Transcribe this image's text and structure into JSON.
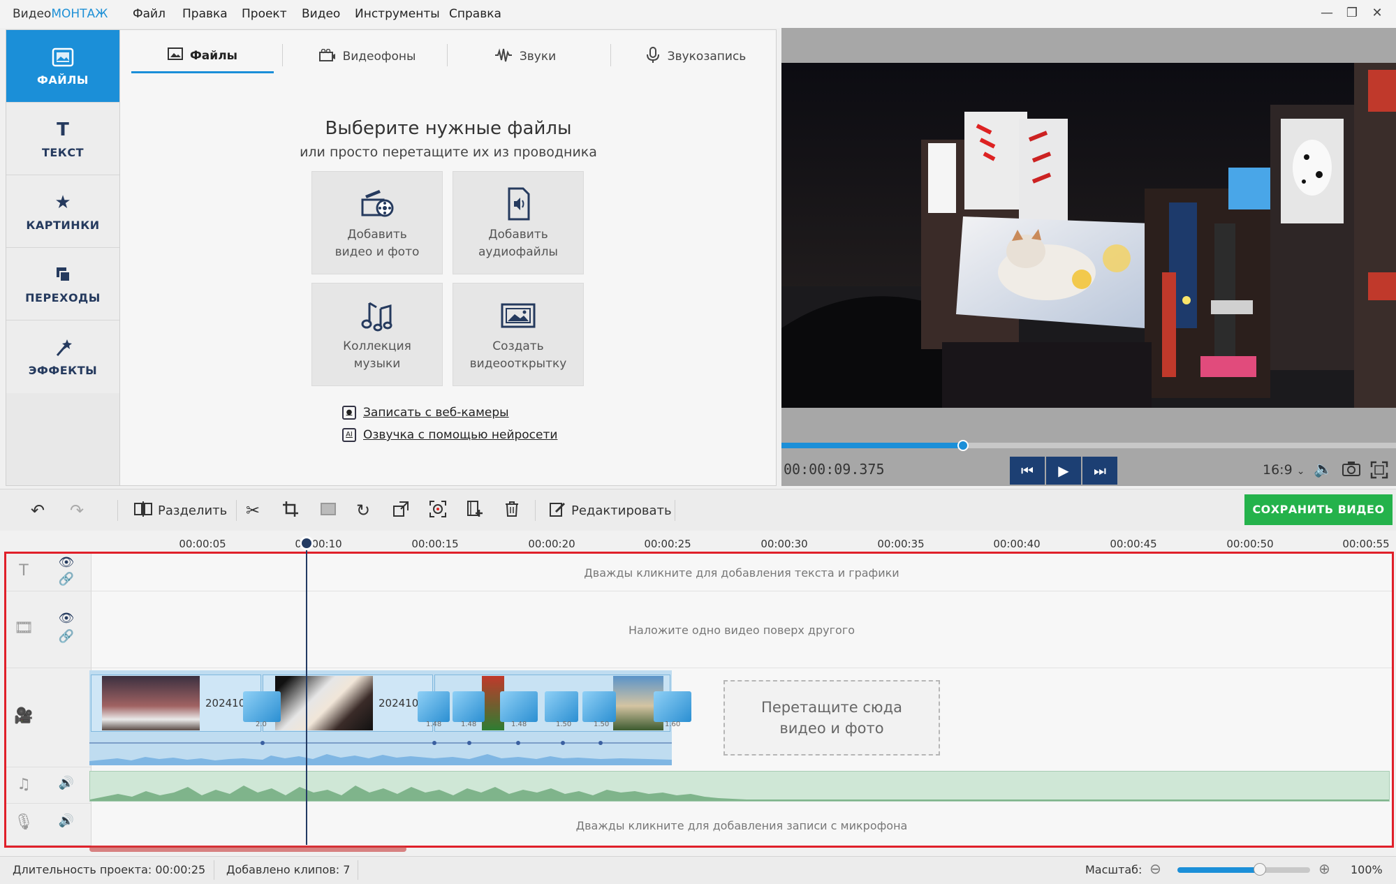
{
  "app": {
    "title_prefix": "Видео",
    "title_accent": "МОНТАЖ"
  },
  "menu": [
    "Файл",
    "Правка",
    "Проект",
    "Видео",
    "Инструменты",
    "Справка"
  ],
  "window_controls": {
    "minimize": "—",
    "restore": "❐",
    "close": "✕"
  },
  "sidebar": {
    "items": [
      {
        "label": "ФАЙЛЫ",
        "icon": "image-icon",
        "active": true
      },
      {
        "label": "ТЕКСТ",
        "icon": "text-icon"
      },
      {
        "label": "КАРТИНКИ",
        "icon": "star-icon"
      },
      {
        "label": "ПЕРЕХОДЫ",
        "icon": "transitions-icon"
      },
      {
        "label": "ЭФФЕКТЫ",
        "icon": "magic-wand-icon"
      }
    ]
  },
  "files_panel": {
    "tabs": [
      {
        "label": "Файлы",
        "icon": "image-icon",
        "active": true
      },
      {
        "label": "Видеофоны",
        "icon": "video-bg-icon"
      },
      {
        "label": "Звуки",
        "icon": "waveform-icon"
      },
      {
        "label": "Звукозапись",
        "icon": "microphone-icon"
      }
    ],
    "heading": "Выберите нужные файлы",
    "subheading": "или просто перетащите их из проводника",
    "buttons": [
      {
        "line1": "Добавить",
        "line2": "видео и фото"
      },
      {
        "line1": "Добавить",
        "line2": "аудиофайлы"
      },
      {
        "line1": "Коллекция",
        "line2": "музыки"
      },
      {
        "line1": "Создать",
        "line2": "видеооткрытку"
      }
    ],
    "links": [
      "Записать с веб-камеры",
      "Озвучка с помощью нейросети"
    ]
  },
  "preview": {
    "timecode": "00:00:09.375",
    "progress": 0.295,
    "aspect": "16:9",
    "aspect_caret": "⌄"
  },
  "toolbar": {
    "split": "Разделить",
    "edit": "Редактировать",
    "save": "СОХРАНИТЬ ВИДЕО"
  },
  "ruler": {
    "ticks": [
      "00:00:05",
      "00:00:10",
      "00:00:15",
      "00:00:20",
      "00:00:25",
      "00:00:30",
      "00:00:35",
      "00:00:40",
      "00:00:45",
      "00:00:50",
      "00:00:55"
    ]
  },
  "timeline": {
    "text_hint": "Дважды кликните для добавления текста и графики",
    "overlay_hint": "Наложите одно видео поверх другого",
    "mic_hint": "Дважды кликните для добавления записи с микрофона",
    "dropzone_line1": "Перетащите сюда",
    "dropzone_line2": "видео и фото",
    "clips": [
      {
        "label": "202410"
      },
      {
        "label": "202410"
      }
    ],
    "transitions": [
      "2.0",
      "1.48",
      "1.48",
      "1.48",
      "1.50",
      "1.50",
      "1.60"
    ]
  },
  "status": {
    "duration_label": "Длительность проекта:",
    "duration": "00:00:25",
    "clips_label": "Добавлено клипов:",
    "clips": "7",
    "scale_label": "Масштаб:",
    "zoom": "100%",
    "zoom_level": 0.62
  },
  "colors": {
    "accent": "#1b8fd8",
    "save": "#24b24b",
    "highlight": "#e0202a",
    "dark": "#1c3f73"
  }
}
